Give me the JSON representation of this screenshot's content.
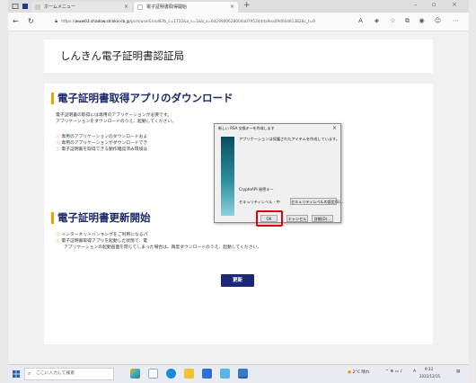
{
  "browser": {
    "tabs": [
      {
        "label": "ホームメニュー"
      },
      {
        "label": "電子証明書取得開始"
      }
    ],
    "url_prefix": "https://",
    "url_host": "www03.shadow.shinkin-ib.jp",
    "url_rest": "/pcm/userEnrollEfb_c=1732&a_s=1&b_s=6d29900628004a0795344da9ea09d004813828c_t=0"
  },
  "page": {
    "site_title": "しんきん電子証明書認証局",
    "section1": {
      "heading": "電子証明書取得アプリのダウンロード",
      "lines": [
        "電子証明書の取得には専用のアプリケーションが必要です。",
        "アプリケーションをダウンロードのうえ、起動してください。"
      ],
      "notes": [
        "専用のアプリケーションのダウンロードおよ",
        "専用のアプリケーションがダウンロードでき",
        "電子証明書を取得できる動作確認済み環境は"
      ]
    },
    "section2": {
      "heading": "電子証明書更新開始",
      "notes": [
        "インターネットバンキングをご利用になるパ",
        "電子証明書取得アプリを起動した状態で、電"
      ],
      "note_cont": "アプリケーションの起動画面を閉じてしまった場合は、再度ダウンロードのうえ、起動してください。",
      "button_label": "更新"
    }
  },
  "dialog": {
    "title": "新しい RSA 交換キーを作成します",
    "message": "アプリケーションは保護されたアイテムを作成しています。",
    "key_name": "CryptoAPI 秘密キー",
    "security_level": "セキュリティレベル - 中",
    "set_level_button": "セキュリティレベルの設定(S)...",
    "ok_button": "OK",
    "cancel_button": "キャンセル",
    "details_button": "詳細(D)..."
  },
  "taskbar": {
    "search_placeholder": "ここに入力して検索",
    "weather": "2°C 晴れ",
    "time": "9:33",
    "date": "2022/12/15",
    "ime": "A"
  },
  "colors": {
    "heading": "#1d2a6b",
    "accent_bar": "#f1a100",
    "primary_button": "#1a2a78",
    "highlight": "#e0000f"
  }
}
